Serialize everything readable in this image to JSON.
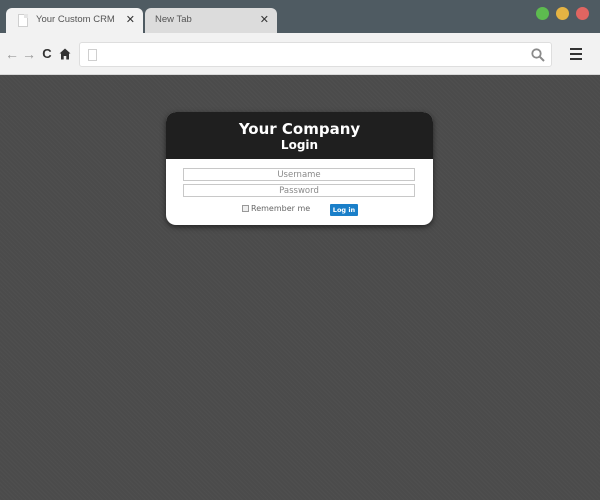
{
  "browser": {
    "tabs": [
      {
        "label": "Your Custom CRM",
        "close": "✕",
        "active": true
      },
      {
        "label": "New Tab",
        "close": "✕",
        "active": false
      }
    ],
    "window_controls": {
      "green": "#5dbb4f",
      "yellow": "#e5b343",
      "red": "#e06561"
    },
    "toolbar": {
      "back_icon": "arrow-left-icon",
      "forward_icon": "arrow-right-icon",
      "reload_icon": "reload-icon",
      "home_icon": "home-icon",
      "address_value": "",
      "search_icon": "search-icon",
      "menu_icon": "hamburger-menu-icon"
    }
  },
  "login": {
    "company_name": "Your Company",
    "title": "Login",
    "username_placeholder": "Username",
    "password_placeholder": "Password",
    "remember_label": "Remember me",
    "submit_label": "Log in",
    "header_color": "#1f1f1f",
    "button_color": "#1a7fc9"
  }
}
